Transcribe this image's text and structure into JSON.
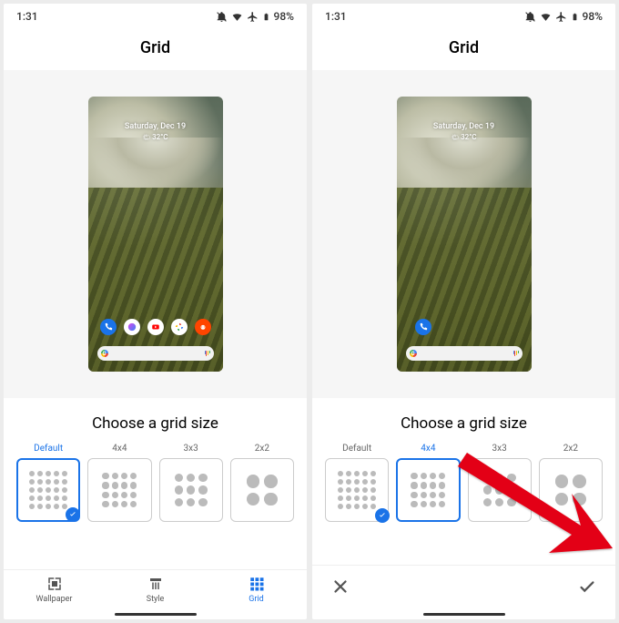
{
  "status": {
    "time": "1:31",
    "battery": "98%"
  },
  "title": "Grid",
  "preview": {
    "date": "Saturday, Dec 19",
    "temp": "32°C"
  },
  "section_label": "Choose a grid size",
  "grid_options": [
    {
      "label": "Default",
      "key": "g5"
    },
    {
      "label": "4x4",
      "key": "g4"
    },
    {
      "label": "3x3",
      "key": "g3"
    },
    {
      "label": "2x2",
      "key": "g2"
    }
  ],
  "left": {
    "active_index": 0,
    "checked_index": 0
  },
  "right": {
    "active_index": 1,
    "checked_index": 0
  },
  "tabs": [
    {
      "label": "Wallpaper"
    },
    {
      "label": "Style"
    },
    {
      "label": "Grid"
    }
  ],
  "active_tab": 2
}
